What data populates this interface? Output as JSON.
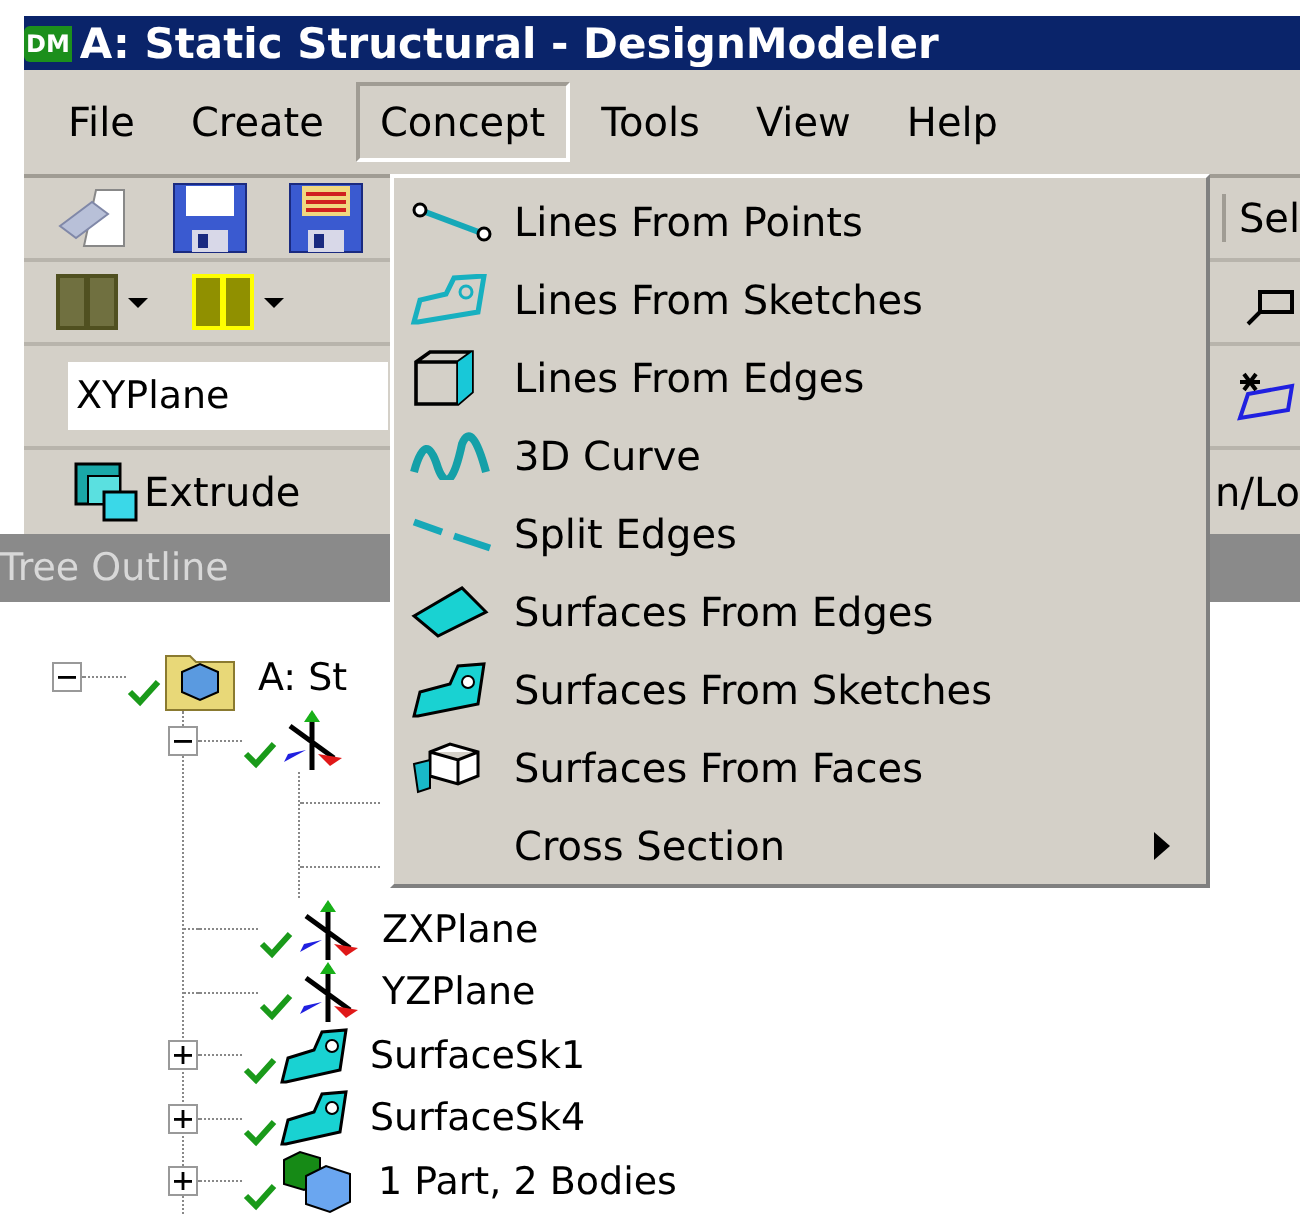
{
  "window": {
    "title": "A: Static Structural - DesignModeler",
    "app_badge": "DM"
  },
  "menu_bar": [
    {
      "label": "File",
      "selected": false
    },
    {
      "label": "Create",
      "selected": false
    },
    {
      "label": "Concept",
      "selected": true
    },
    {
      "label": "Tools",
      "selected": false
    },
    {
      "label": "View",
      "selected": false
    },
    {
      "label": "Help",
      "selected": false
    }
  ],
  "toolbar": {
    "right_label": "Sel"
  },
  "plane_field": {
    "value": "XYPlane"
  },
  "feature_toolbar": {
    "extrude": "Extrude",
    "right_label": "n/Lo"
  },
  "tree_outline": {
    "title": "Tree Outline",
    "items": [
      {
        "kind": "model",
        "label": "A: St",
        "checked": true,
        "expanded": true,
        "children": [
          {
            "kind": "axes",
            "checked": true,
            "expanded": true,
            "children": [
              {
                "kind": "hidden"
              },
              {
                "kind": "hidden"
              }
            ]
          },
          {
            "kind": "axes",
            "label": "ZXPlane",
            "checked": true
          },
          {
            "kind": "axes",
            "label": "YZPlane",
            "checked": true
          },
          {
            "kind": "surface",
            "label": "SurfaceSk1",
            "checked": true,
            "expanded": false
          },
          {
            "kind": "surface",
            "label": "SurfaceSk4",
            "checked": true,
            "expanded": false
          },
          {
            "kind": "part",
            "label": "1 Part, 2 Bodies",
            "checked": true,
            "expanded": false
          }
        ]
      }
    ]
  },
  "concept_menu": {
    "items": [
      {
        "label": "Lines From Points",
        "submenu": false
      },
      {
        "label": "Lines From Sketches",
        "submenu": false
      },
      {
        "label": "Lines From Edges",
        "submenu": false
      },
      {
        "label": "3D Curve",
        "submenu": false
      },
      {
        "label": "Split Edges",
        "submenu": false
      },
      {
        "label": "Surfaces From Edges",
        "submenu": false
      },
      {
        "label": "Surfaces From Sketches",
        "submenu": false
      },
      {
        "label": "Surfaces From Faces",
        "submenu": false
      },
      {
        "label": "Cross Section",
        "submenu": true
      }
    ]
  }
}
